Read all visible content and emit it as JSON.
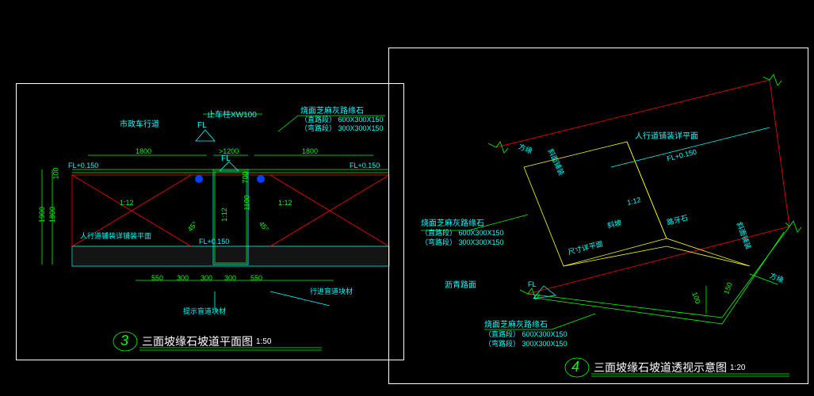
{
  "left": {
    "num": "3",
    "title": "三面坡缘石坡道平面图",
    "scale": "1:50",
    "labels": {
      "road": "市政车行道",
      "stop_block": "止车柱XW100",
      "curb": "烧面芝麻灰路缘石",
      "curb_straight": "（直路段）  600X300X150",
      "curb_curve": "（弯路段）  300X300X150",
      "fl": "FL",
      "fl150_l": "FL+0.150",
      "fl150_r": "FL+0.150",
      "slope": "1:12",
      "slope2": "1:12",
      "slope_v": "1:12",
      "a45_l": "45°",
      "a45_r": "45°",
      "fl150_b": "FL+0.150",
      "ped": "人行道铺装详铺装平面",
      "blind_hint": "提示盲道块材",
      "blind_walk": "行进盲道块材",
      "d1800a": "1800",
      "d1800b": "1800",
      "d1200": ">1200",
      "d550a": "550",
      "d550b": "550",
      "d300a": "300",
      "d300b": "300",
      "d300c": "300",
      "dV1800": "1800",
      "dV1900": "1900",
      "dV100": "100",
      "dV1100": "1100",
      "dV700": "700"
    }
  },
  "right": {
    "num": "4",
    "title": "三面坡缘石坡道透视示意图",
    "scale": "1:20",
    "labels": {
      "ped_plane": "人行道铺装详平面",
      "slope_l": "方缘",
      "slope_r": "方缘",
      "sidewalk_stone": "斜面铺装",
      "sidewalk_stone_r": "斜面铺装",
      "fl150": "FL+0.150",
      "slope_1_12": "1:12",
      "road_tooth": "路牙石",
      "slope_center": "斜坡",
      "sizeA": "尺寸详平面",
      "curb": "烧面芝麻灰路缘石",
      "curb_straight": "（直路段）  600X300X150",
      "curb_curve": "（弯路段）  300X300X150",
      "asphalt": "沥青路面",
      "fl": "FL",
      "curb2": "烧面芝麻灰路缘石",
      "curb2_straight": "（直路段）  600X300X150",
      "curb2_curve": "（弯路段）  300X300X150",
      "d100": "100",
      "d150": "150"
    }
  }
}
